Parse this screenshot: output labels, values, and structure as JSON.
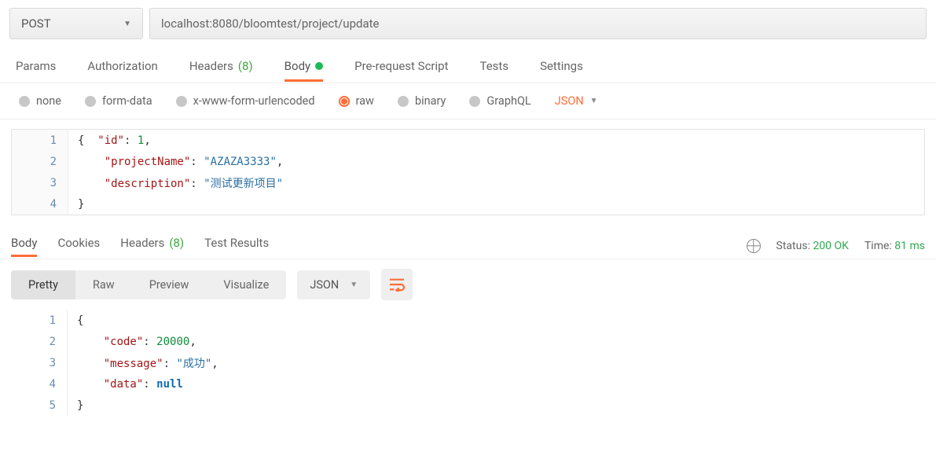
{
  "request": {
    "method": "POST",
    "url": "localhost:8080/bloomtest/project/update"
  },
  "tabs": {
    "params": "Params",
    "authorization": "Authorization",
    "headers": "Headers",
    "headers_count": "(8)",
    "body": "Body",
    "prerequest": "Pre-request Script",
    "tests": "Tests",
    "settings": "Settings"
  },
  "body_types": {
    "none": "none",
    "form_data": "form-data",
    "urlencoded": "x-www-form-urlencoded",
    "raw": "raw",
    "binary": "binary",
    "graphql": "GraphQL",
    "json_dd": "JSON"
  },
  "request_body_lines": [
    "{  \"id\": 1,",
    "    \"projectName\": \"AZAZA3333\",",
    "    \"description\": \"测试更新项目\"",
    "}"
  ],
  "request_body_json": {
    "id": 1,
    "projectName": "AZAZA3333",
    "description": "测试更新项目"
  },
  "response_tabs": {
    "body": "Body",
    "cookies": "Cookies",
    "headers": "Headers",
    "headers_count": "(8)",
    "test_results": "Test Results"
  },
  "response_meta": {
    "status_label": "Status:",
    "status_value": "200 OK",
    "time_label": "Time:",
    "time_value": "81 ms"
  },
  "response_toolbar": {
    "pretty": "Pretty",
    "raw": "Raw",
    "preview": "Preview",
    "visualize": "Visualize",
    "format": "JSON"
  },
  "response_body_lines": [
    "{",
    "    \"code\": 20000,",
    "    \"message\": \"成功\",",
    "    \"data\": null",
    "}"
  ],
  "response_body_json": {
    "code": 20000,
    "message": "成功",
    "data": null
  }
}
